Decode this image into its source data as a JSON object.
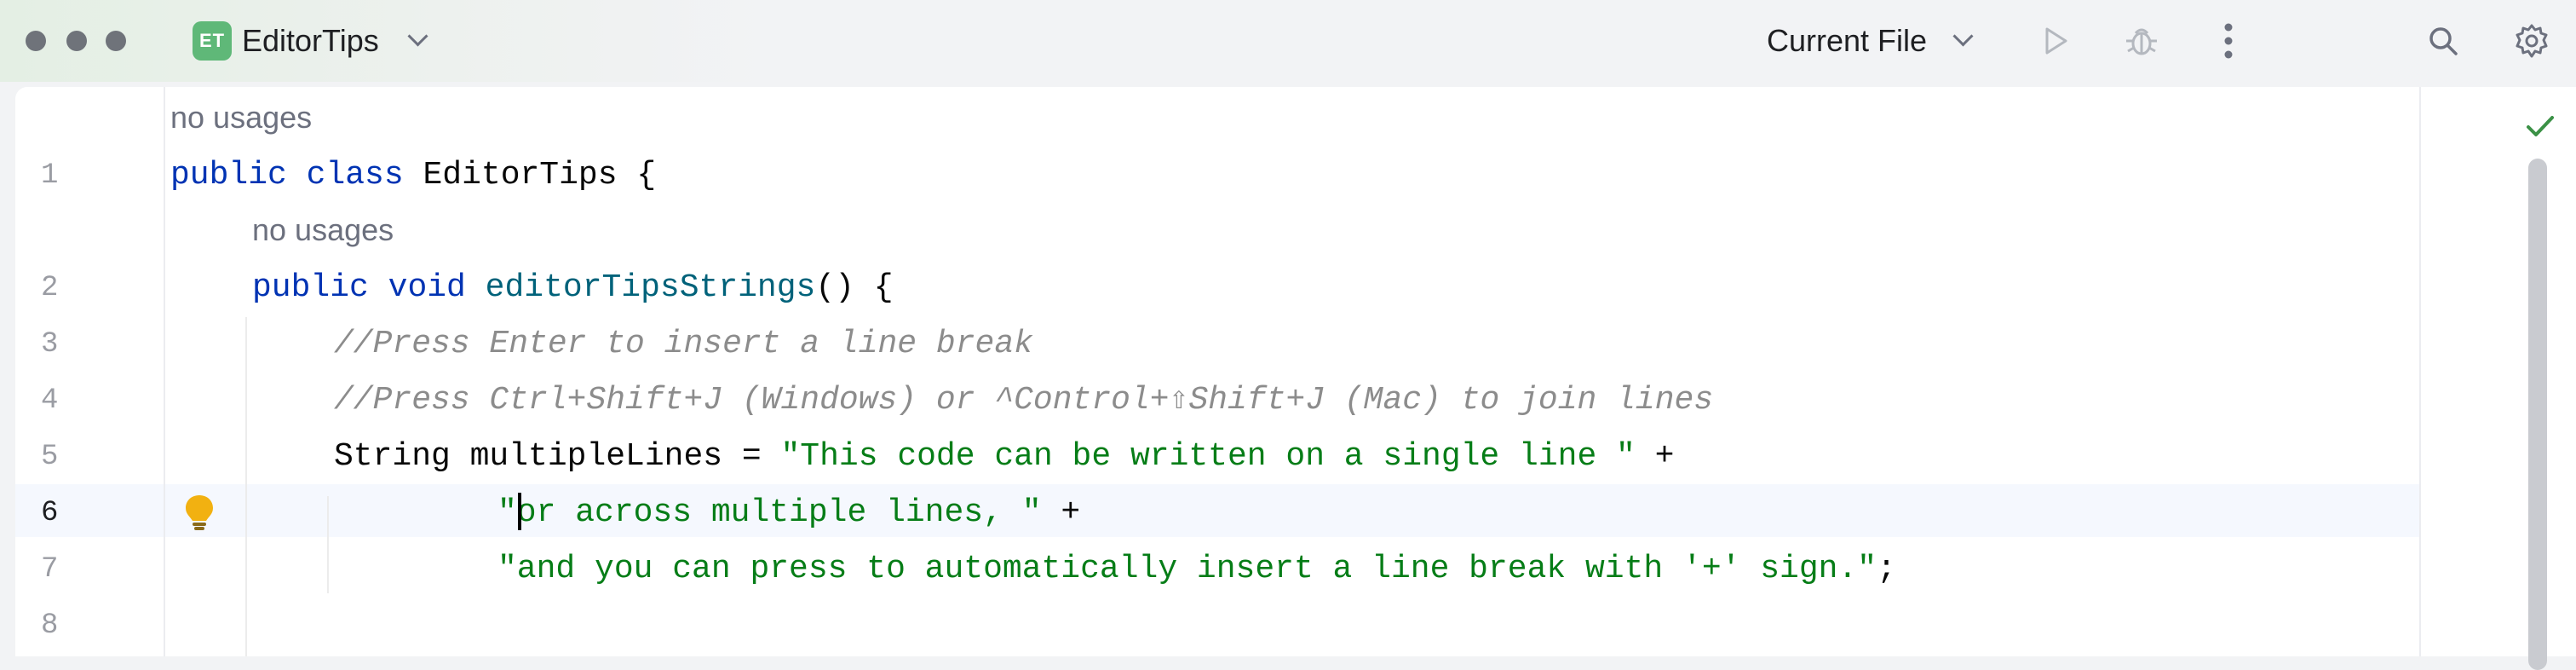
{
  "window": {
    "project_badge": "ET",
    "project_name": "EditorTips",
    "run_configuration": "Current File"
  },
  "toolbar_icons": [
    "chevron-down-icon",
    "run-icon",
    "debug-icon",
    "more-icon",
    "search-icon",
    "settings-icon"
  ],
  "editor": {
    "usage_hint_class": "no usages",
    "usage_hint_method": "no usages",
    "inspection_status": "no-problems-check-icon",
    "current_line": 6,
    "line_numbers": [
      "1",
      "2",
      "3",
      "4",
      "5",
      "6",
      "7",
      "8"
    ],
    "lines": {
      "l1": {
        "kw1": "public",
        "kw2": "class",
        "name": "EditorTips",
        "rest": "{"
      },
      "l2": {
        "kw1": "public",
        "kw2": "void",
        "name": "editorTipsStrings",
        "rest": "() {"
      },
      "l3": {
        "comment": "//Press Enter to insert a line break"
      },
      "l4": {
        "comment": "//Press Ctrl+Shift+J (Windows) or ^Control+⇧Shift+J (Mac) to join lines"
      },
      "l5": {
        "decl": "String multipleLines = ",
        "str": "\"This code can be written on a single line \"",
        "op": " +"
      },
      "l6": {
        "str": "\"or across multiple lines, \"",
        "op": " +"
      },
      "l7": {
        "str": "\"and you can press to automatically insert a line break with '+' sign.\"",
        "op": ";"
      }
    }
  },
  "colors": {
    "keyword": "#0033b3",
    "method": "#00627a",
    "string": "#067d17",
    "comment": "#8c8c8c",
    "project_badge": "#5fb878",
    "check": "#3b9146",
    "bulb": "#f2b111"
  }
}
